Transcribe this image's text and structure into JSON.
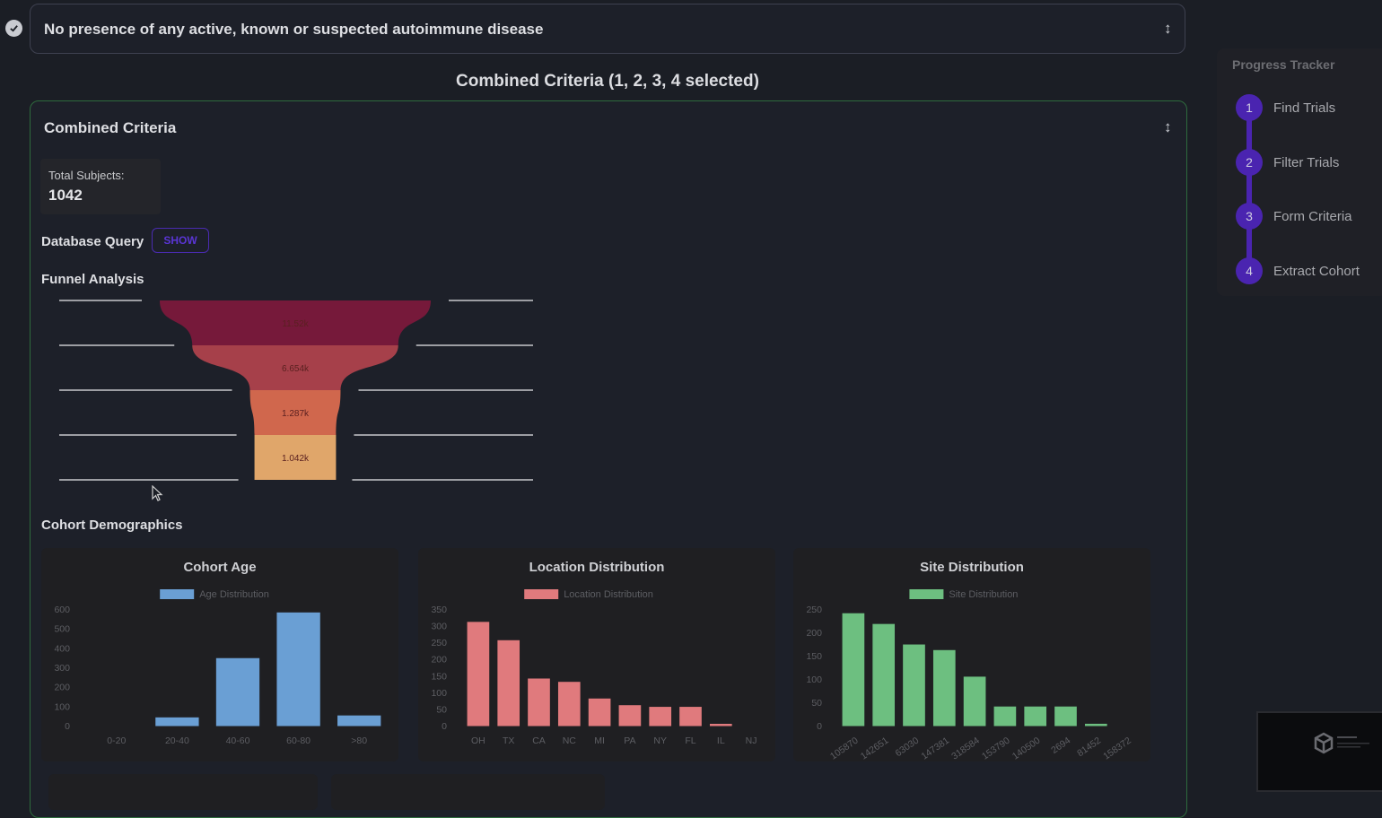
{
  "top_criterion": {
    "text": "No presence of any active, known or suspected autoimmune disease",
    "checked": true
  },
  "combined_heading": "Combined Criteria (1, 2, 3, 4 selected)",
  "combined_card": {
    "title": "Combined Criteria",
    "total_subjects_label": "Total Subjects:",
    "total_subjects_value": "1042",
    "database_query_label": "Database Query",
    "show_button": "SHOW",
    "funnel_label": "Funnel Analysis",
    "demographics_label": "Cohort Demographics"
  },
  "progress_tracker": {
    "title": "Progress Tracker",
    "steps": [
      {
        "num": "1",
        "label": "Find Trials"
      },
      {
        "num": "2",
        "label": "Filter Trials"
      },
      {
        "num": "3",
        "label": "Form Criteria"
      },
      {
        "num": "4",
        "label": "Extract Cohort"
      }
    ],
    "accent": "#4a24b0"
  },
  "chart_data": [
    {
      "type": "funnel",
      "title": "Funnel Analysis",
      "stages": [
        {
          "label": "11.52k",
          "value": 11520,
          "color": "#76193a"
        },
        {
          "label": "6.654k",
          "value": 6654,
          "color": "#a6404a"
        },
        {
          "label": "1.287k",
          "value": 1287,
          "color": "#d0674d"
        },
        {
          "label": "1.042k",
          "value": 1042,
          "color": "#e0a66a"
        }
      ]
    },
    {
      "type": "bar",
      "title": "Cohort Age",
      "legend": "Age Distribution",
      "color": "#6a9fd4",
      "categories": [
        "0-20",
        "20-40",
        "40-60",
        "60-80",
        ">80"
      ],
      "values": [
        0,
        40,
        345,
        580,
        50
      ],
      "yticks": [
        0,
        100,
        200,
        300,
        400,
        500,
        600
      ],
      "ylim": [
        0,
        600
      ],
      "legend_position": "top"
    },
    {
      "type": "bar",
      "title": "Location Distribution",
      "legend": "Location Distribution",
      "color": "#e07a7d",
      "categories": [
        "OH",
        "TX",
        "CA",
        "NC",
        "MI",
        "PA",
        "NY",
        "FL",
        "IL",
        "NJ"
      ],
      "values": [
        310,
        255,
        140,
        130,
        80,
        60,
        55,
        55,
        3,
        0
      ],
      "yticks": [
        0,
        50,
        100,
        150,
        200,
        250,
        300,
        350
      ],
      "ylim": [
        0,
        350
      ],
      "legend_position": "top"
    },
    {
      "type": "bar",
      "title": "Site Distribution",
      "legend": "Site Distribution",
      "color": "#6dbf80",
      "categories": [
        "105870",
        "142651",
        "63030",
        "147381",
        "318584",
        "153790",
        "140500",
        "2694",
        "81452",
        "158372"
      ],
      "values": [
        240,
        217,
        173,
        161,
        104,
        40,
        40,
        40,
        3,
        0
      ],
      "yticks": [
        0,
        50,
        100,
        150,
        200,
        250
      ],
      "ylim": [
        0,
        250
      ],
      "rotated_labels": true,
      "legend_position": "top"
    }
  ]
}
